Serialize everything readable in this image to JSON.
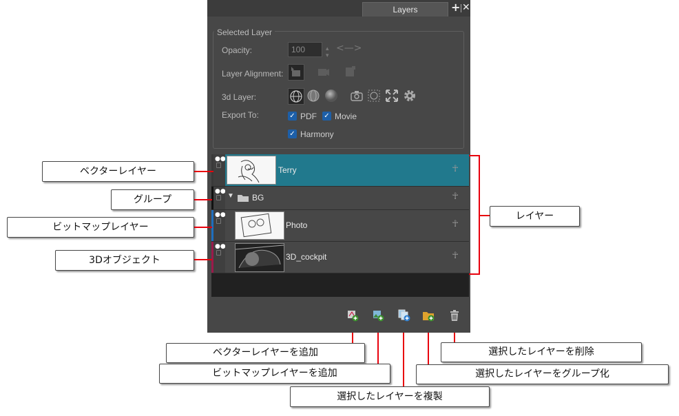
{
  "panel": {
    "tab_label": "Layers",
    "add_icon": "plus-icon",
    "close_icon": "close-icon"
  },
  "selected_layer": {
    "legend": "Selected Layer",
    "opacity_label": "Opacity:",
    "opacity_value": "100",
    "alignment_label": "Layer Alignment:",
    "layer3d_label": "3d Layer:",
    "export_label": "Export To:",
    "export_options": [
      "PDF",
      "Movie",
      "Harmony"
    ]
  },
  "layers": [
    {
      "name": "Terry",
      "type": "vector",
      "selected": true
    },
    {
      "name": "BG",
      "type": "group",
      "selected": false
    },
    {
      "name": "Photo",
      "type": "bitmap",
      "selected": false
    },
    {
      "name": "3D_cockpit",
      "type": "3d",
      "selected": false
    }
  ],
  "toolbar": {
    "icons": [
      "add-vector-layer-icon",
      "add-bitmap-layer-icon",
      "duplicate-layer-icon",
      "group-layers-icon",
      "delete-layer-icon"
    ]
  },
  "callouts": {
    "vector_layer": "ベクターレイヤー",
    "group": "グループ",
    "bitmap_layer": "ビットマップレイヤー",
    "object_3d": "3Dオブジェクト",
    "layers": "レイヤー",
    "add_vector": "ベクターレイヤーを追加",
    "add_bitmap": "ビットマップレイヤーを追加",
    "duplicate": "選択したレイヤーを複製",
    "delete": "選択したレイヤーを削除",
    "group_selected": "選択したレイヤーをグループ化"
  },
  "colors": {
    "panel_bg": "#474747",
    "selected_row": "#21798d",
    "callout_line": "#e8000c",
    "checkbox": "#1d5fa8"
  }
}
